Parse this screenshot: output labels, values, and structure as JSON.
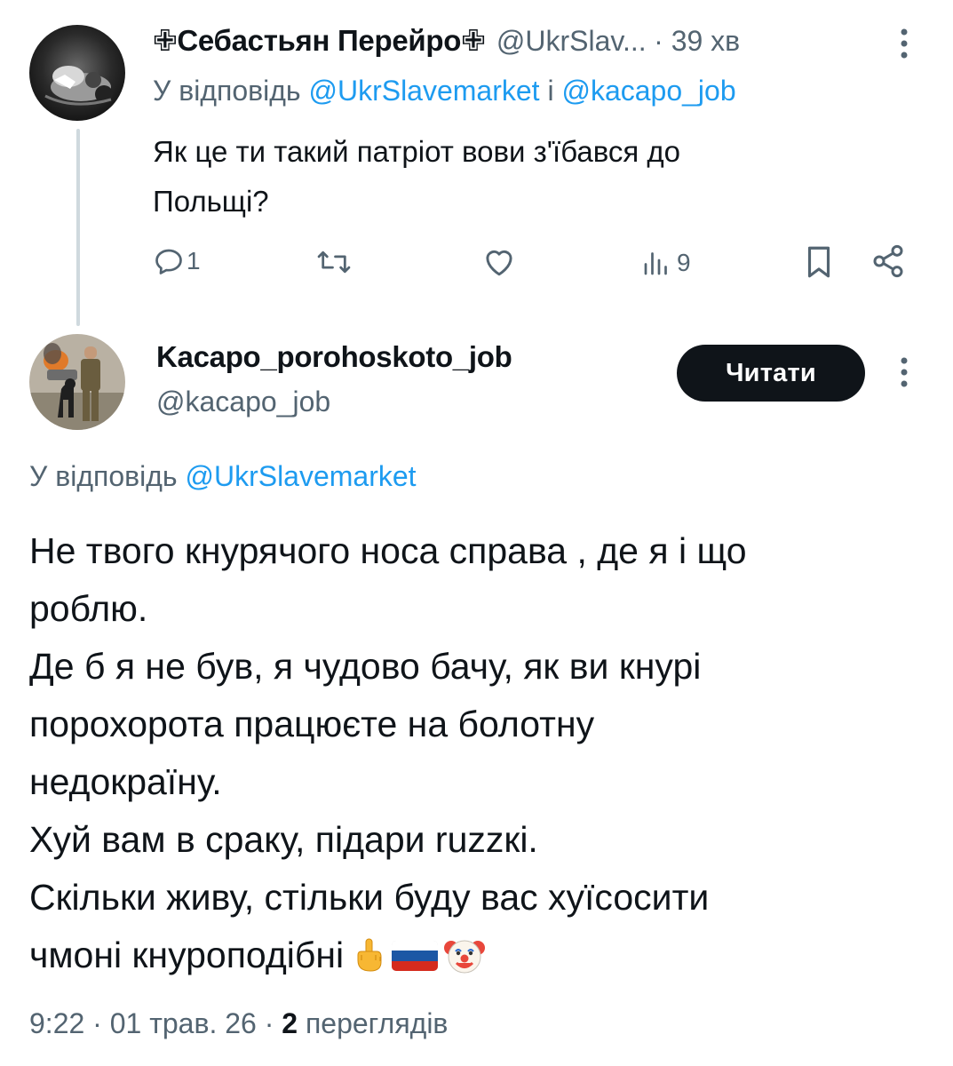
{
  "reply_tweet": {
    "display_name": "✙Себастьян Перейро✙",
    "handle": "@UkrSlav...",
    "time": "· 39 хв",
    "reply_prefix": "У відповідь",
    "reply_to_1": "@UkrSlavemarket",
    "reply_and": "і",
    "reply_to_2": "@kacapo_job",
    "text_line1": "Як це ти такий патріот вови  з'їбався до",
    "text_line2": "Польщі?",
    "actions": {
      "reply_count": "1",
      "retweet_count": "",
      "like_count": "",
      "views_count": "9"
    }
  },
  "main_tweet": {
    "display_name": "Kacapo_porohoskoto_job",
    "handle": "@kacapo_job",
    "follow_label": "Читати",
    "reply_prefix": "У відповідь",
    "reply_to": "@UkrSlavemarket",
    "body_lines": [
      "Не твого кнурячого носа справа , де я і що",
      "роблю.",
      "Де б я не був, я чудово бачу, як ви кнурі",
      "порохорота працюєте на болотну",
      "недокраїну.",
      "Хуй вам в сраку, підари ruzzкі.",
      "Скільки живу, стільки буду вас хуїсосити",
      "чмоні кнуроподібні"
    ],
    "emojis": [
      "middle-finger",
      "russian-flag",
      "clown-face"
    ],
    "meta_time": "9:22 · 01 трав. 26 ·",
    "meta_views_count": "2",
    "meta_views_label": "переглядів"
  },
  "colors": {
    "accent": "#1d9bf0",
    "muted": "#536471",
    "text": "#0f1419",
    "thread_line": "#cfd9de"
  }
}
